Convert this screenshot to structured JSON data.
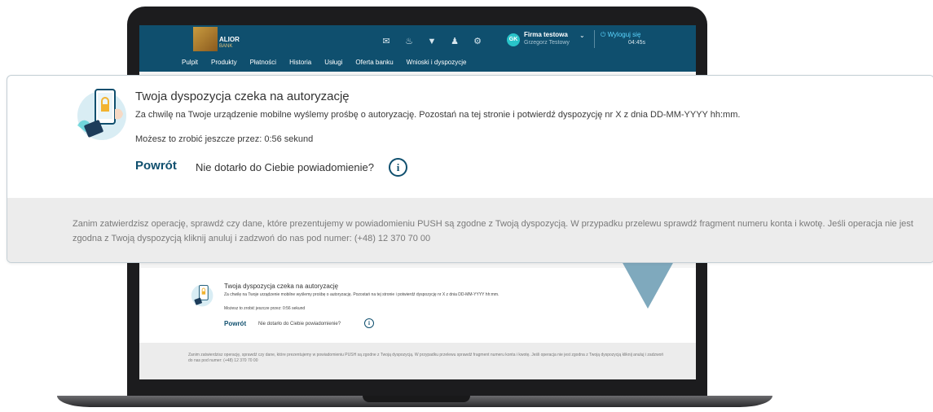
{
  "bank": {
    "logo_text": "ALIOR",
    "logo_sub": "BANK",
    "nav": [
      "Pulpit",
      "Produkty",
      "Płatności",
      "Historia",
      "Usługi",
      "Oferta banku",
      "Wnioski i dyspozycje"
    ],
    "user": {
      "initials": "GK",
      "firm": "Firma testowa",
      "name": "Grzegorz Testowy"
    },
    "logout_label": "Wyloguj się",
    "session_time": "04:45s"
  },
  "auth_card": {
    "title": "Twoja dyspozycja czeka na autoryzację",
    "description": "Za chwilę na Twoje urządzenie mobilne wyślemy prośbę o autoryzację. Pozostań na tej stronie i potwierdź dyspozycję nr X z dnia DD-MM-YYYY hh:mm.",
    "timer": "Możesz to zrobić jeszcze przez: 0:56 sekund",
    "back_label": "Powrót",
    "notification_question": "Nie dotarło do Ciebie powiadomienie?",
    "info_symbol": "i",
    "footer": "Zanim zatwierdzisz operację, sprawdź czy dane, które prezentujemy w powiadomieniu PUSH  są zgodne z Twoją dyspozycją. W przypadku przelewu sprawdź fragment numeru konta i kwotę. Jeśli operacja nie jest zgodna z Twoją dyspozycją kliknij anuluj i zadzwoń do nas pod numer: (+48) 12 370 70 00"
  },
  "colors": {
    "header": "#0f4f6e",
    "accent": "#29c4c9",
    "link": "#0f4f6e"
  },
  "icons": [
    "mail-icon",
    "bell-icon",
    "download-icon",
    "user-icon",
    "settings-icon",
    "power-icon",
    "info-icon",
    "phone-lock-illustration"
  ]
}
